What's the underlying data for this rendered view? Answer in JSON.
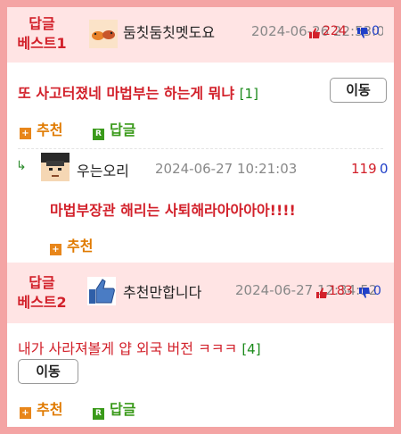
{
  "best1": {
    "label_line1": "답글",
    "label_line2": "베스트1",
    "nickname": "둠칫둠칫멧도요",
    "date": "2024-06-26 22:53:03",
    "up": "224",
    "down": "0"
  },
  "post1": {
    "title": "또 사고터졌네 마법부는 하는게 뭐냐",
    "reply_count": "[1]",
    "move_label": "이동",
    "recommend_label": "추천",
    "reply_label": "답글"
  },
  "comment1": {
    "reply_mark": "↳",
    "nickname": "우는오리",
    "date": "2024-06-27 10:21:03",
    "up": "119",
    "down": "0",
    "text": "마법부장관 해리는 사퇴해라아아아아!!!!",
    "recommend_label": "추천"
  },
  "best2": {
    "label_line1": "답글",
    "label_line2": "베스트2",
    "nickname": "추천만합니다",
    "date": "2024-06-27 12:34:52",
    "up": "183",
    "down": "0"
  },
  "post2": {
    "title": "내가 사라져볼게 얍 외국 버전 ㅋㅋㅋ",
    "reply_count": "[4]",
    "move_label": "이동",
    "recommend_label": "추천",
    "reply_label": "답글"
  },
  "colors": {
    "accent_red": "#d2202a",
    "border_pink": "#f4a4a4",
    "best_bg": "#ffe4e4",
    "down_blue": "#2040c8",
    "reply_green": "#3a9a1a"
  }
}
